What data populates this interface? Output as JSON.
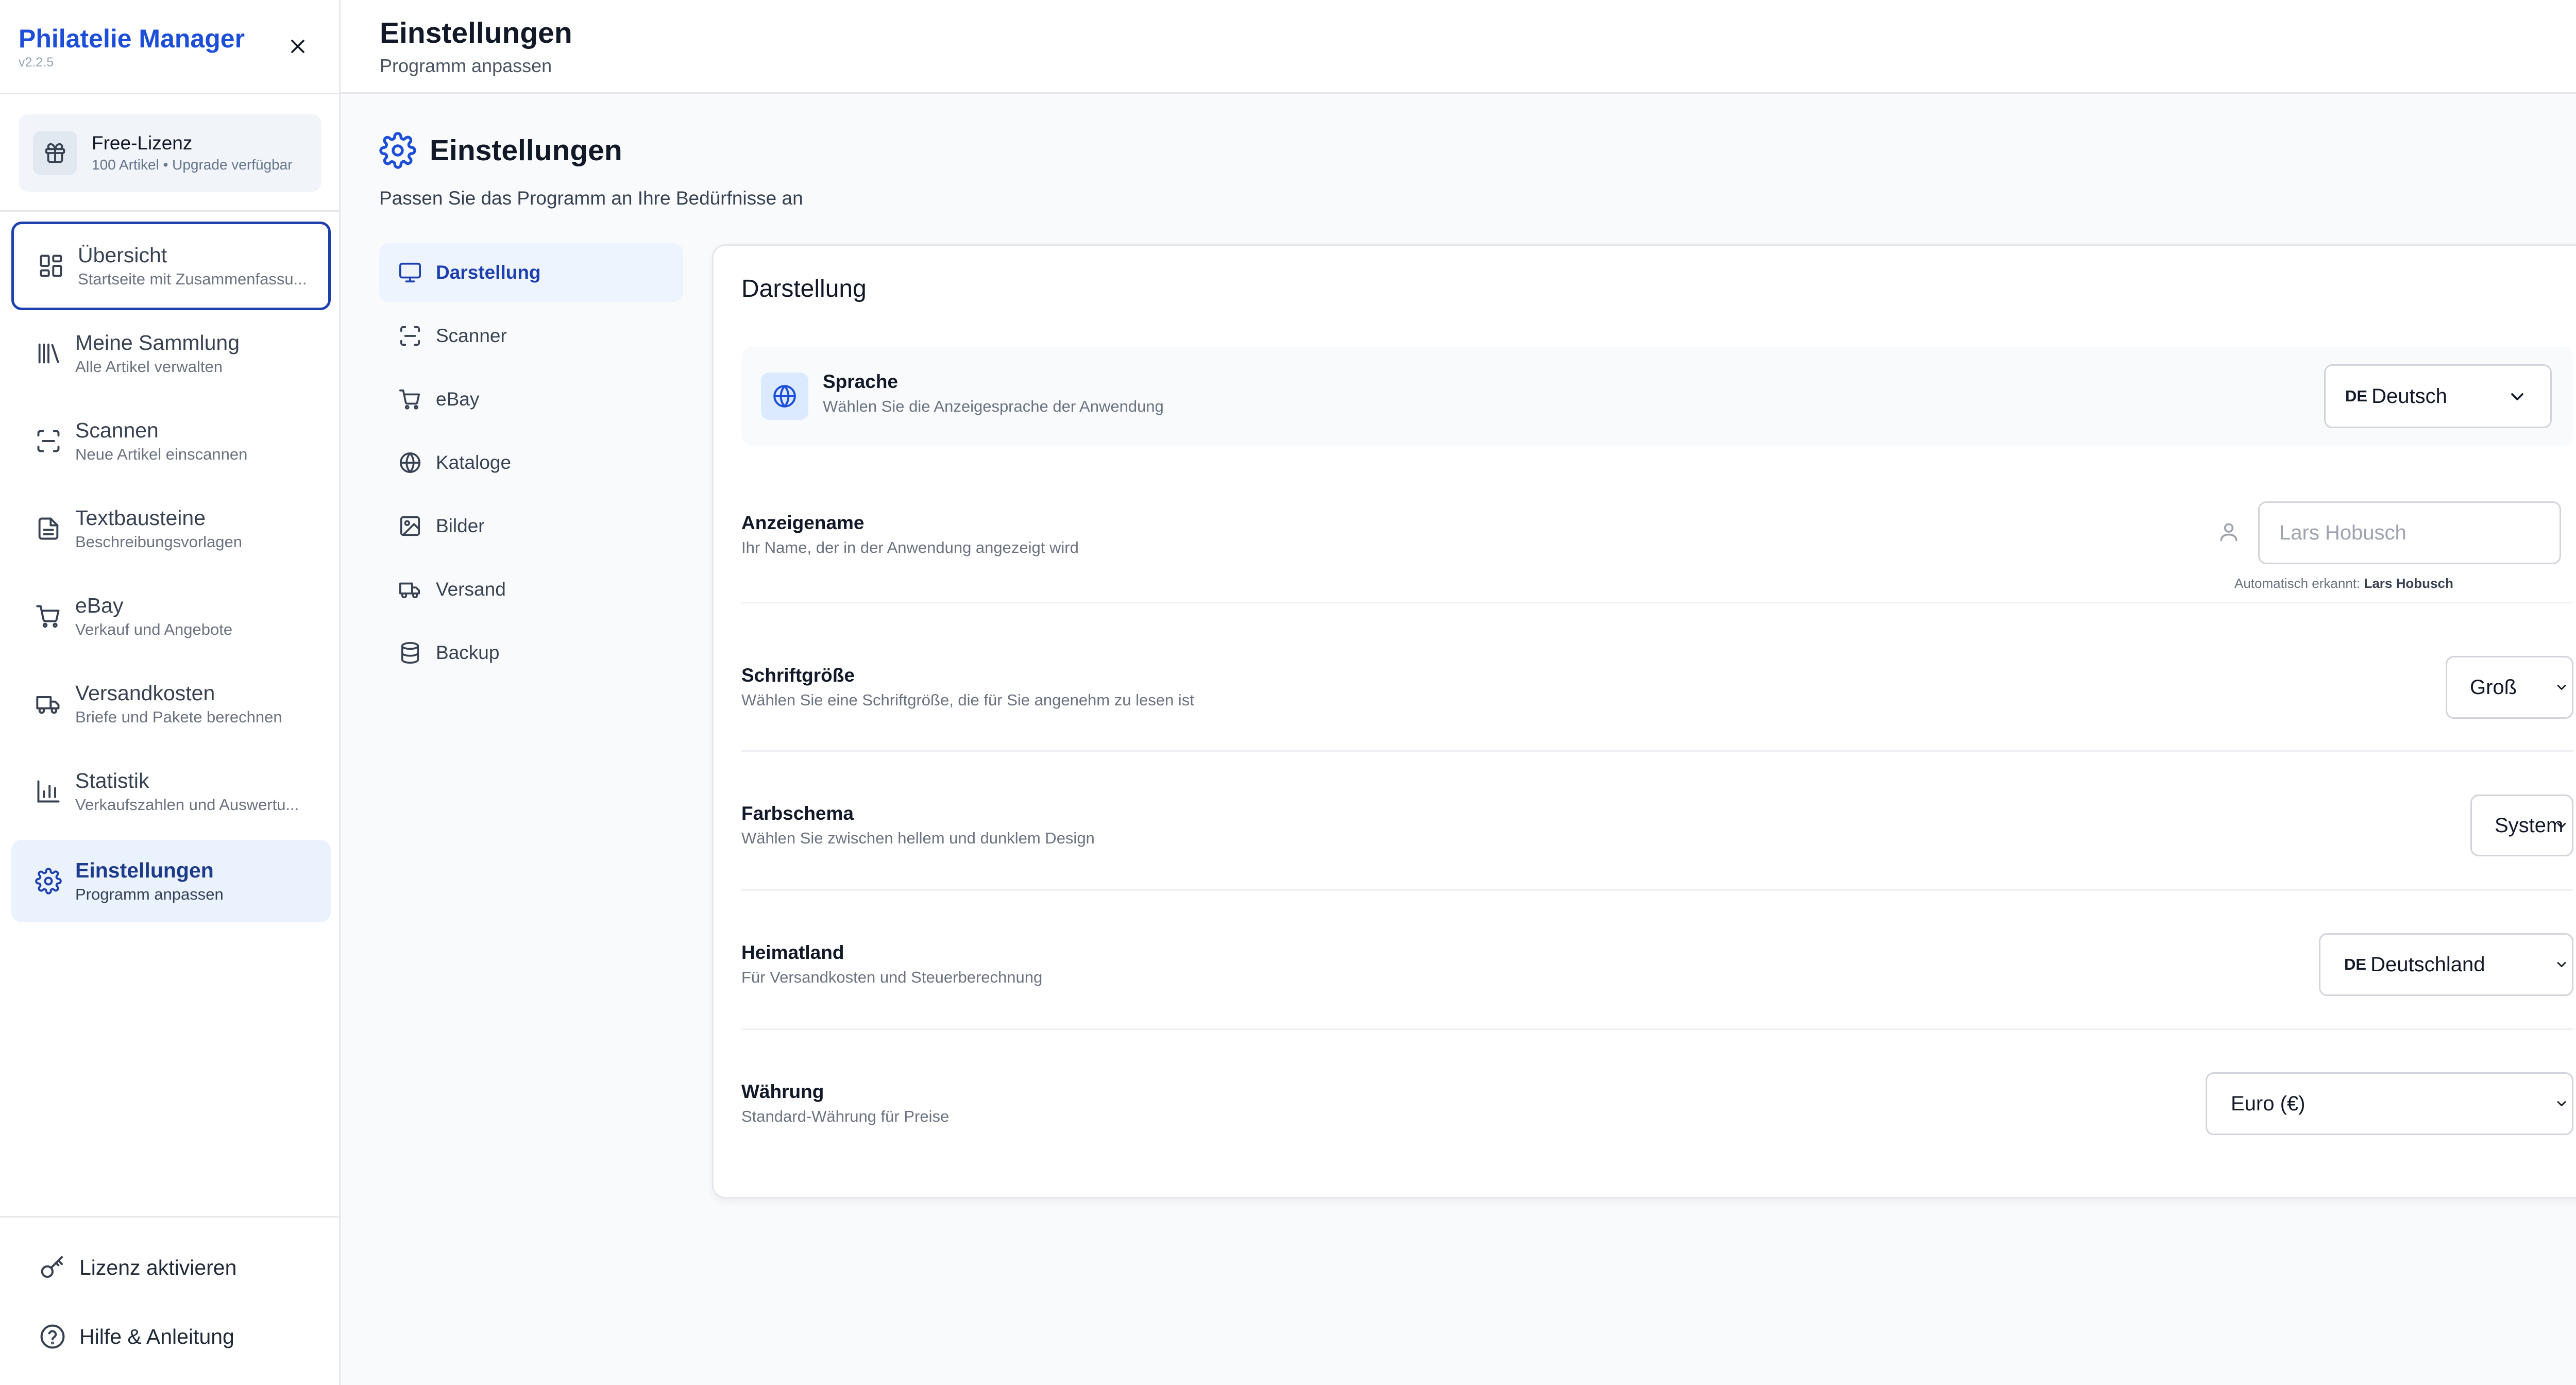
{
  "app": {
    "title": "Philatelie Manager",
    "version": "v2.2.5"
  },
  "license": {
    "title": "Free-Lizenz",
    "subtitle": "100 Artikel • Upgrade verfügbar"
  },
  "nav": [
    {
      "label": "Übersicht",
      "sub": "Startseite mit Zusammenfassu...",
      "icon": "dashboard-icon"
    },
    {
      "label": "Meine Sammlung",
      "sub": "Alle Artikel verwalten",
      "icon": "library-icon"
    },
    {
      "label": "Scannen",
      "sub": "Neue Artikel einscannen",
      "icon": "scan-icon"
    },
    {
      "label": "Textbausteine",
      "sub": "Beschreibungsvorlagen",
      "icon": "document-icon"
    },
    {
      "label": "eBay",
      "sub": "Verkauf und Angebote",
      "icon": "cart-icon"
    },
    {
      "label": "Versandkosten",
      "sub": "Briefe und Pakete berechnen",
      "icon": "truck-icon"
    },
    {
      "label": "Statistik",
      "sub": "Verkaufszahlen und Auswertu...",
      "icon": "bar-chart-icon"
    },
    {
      "label": "Einstellungen",
      "sub": "Programm anpassen",
      "icon": "gear-icon"
    }
  ],
  "footer": {
    "activate_license": "Lizenz aktivieren",
    "help": "Hilfe & Anleitung"
  },
  "header": {
    "title": "Einstellungen",
    "subtitle": "Programm anpassen"
  },
  "page": {
    "title": "Einstellungen",
    "description": "Passen Sie das Programm an Ihre Bedürfnisse an"
  },
  "tabs": [
    {
      "label": "Darstellung",
      "icon": "monitor-icon"
    },
    {
      "label": "Scanner",
      "icon": "scan-icon"
    },
    {
      "label": "eBay",
      "icon": "cart-icon"
    },
    {
      "label": "Kataloge",
      "icon": "globe-icon"
    },
    {
      "label": "Bilder",
      "icon": "image-icon"
    },
    {
      "label": "Versand",
      "icon": "truck-icon"
    },
    {
      "label": "Backup",
      "icon": "database-icon"
    }
  ],
  "panel": {
    "title": "Darstellung",
    "language": {
      "title": "Sprache",
      "subtitle": "Wählen Sie die Anzeigesprache der Anwendung",
      "flag": "DE",
      "value": "Deutsch"
    },
    "display_name": {
      "title": "Anzeigename",
      "subtitle": "Ihr Name, der in der Anwendung angezeigt wird",
      "placeholder": "Lars Hobusch",
      "auto_detected_label": "Automatisch erkannt:",
      "auto_detected_value": "Lars Hobusch"
    },
    "font_size": {
      "title": "Schriftgröße",
      "subtitle": "Wählen Sie eine Schriftgröße, die für Sie angenehm zu lesen ist",
      "value": "Groß"
    },
    "color_scheme": {
      "title": "Farbschema",
      "subtitle": "Wählen Sie zwischen hellem und dunklem Design",
      "value": "System"
    },
    "home_country": {
      "title": "Heimatland",
      "subtitle": "Für Versandkosten und Steuerberechnung",
      "flag": "DE",
      "value": "Deutschland"
    },
    "currency": {
      "title": "Währung",
      "subtitle": "Standard-Währung für Preise",
      "value": "Euro (€)"
    }
  },
  "colors": {
    "accent": "#1d4ed8",
    "active_bg": "#eaf2fe",
    "border": "#e5e7eb"
  }
}
